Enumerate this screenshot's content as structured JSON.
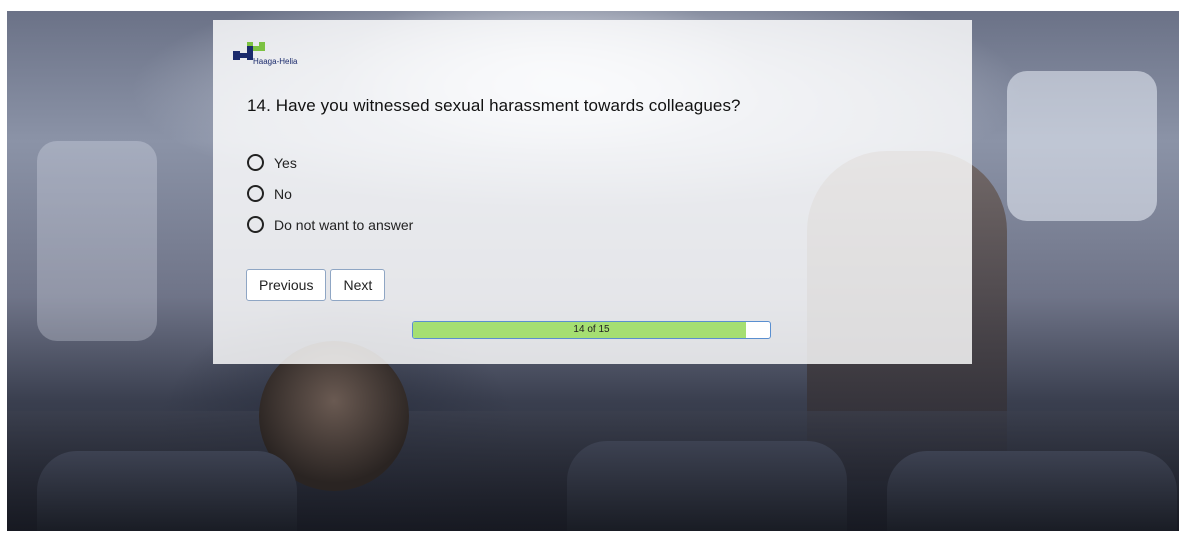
{
  "survey": {
    "logo_text": "Haaga-Helia",
    "question": "14. Have you witnessed sexual harassment towards colleagues?",
    "options": [
      "Yes",
      "No",
      "Do not want to answer"
    ],
    "previous_label": "Previous",
    "next_label": "Next",
    "progress_text": "14 of 15",
    "progress_fraction": 0.933
  },
  "colors": {
    "progress_fill": "#a5df72",
    "progress_border": "#5a8fd0",
    "button_border": "#8fa6c4",
    "logo_blue": "#1a2a6c",
    "logo_green": "#7cc242"
  }
}
